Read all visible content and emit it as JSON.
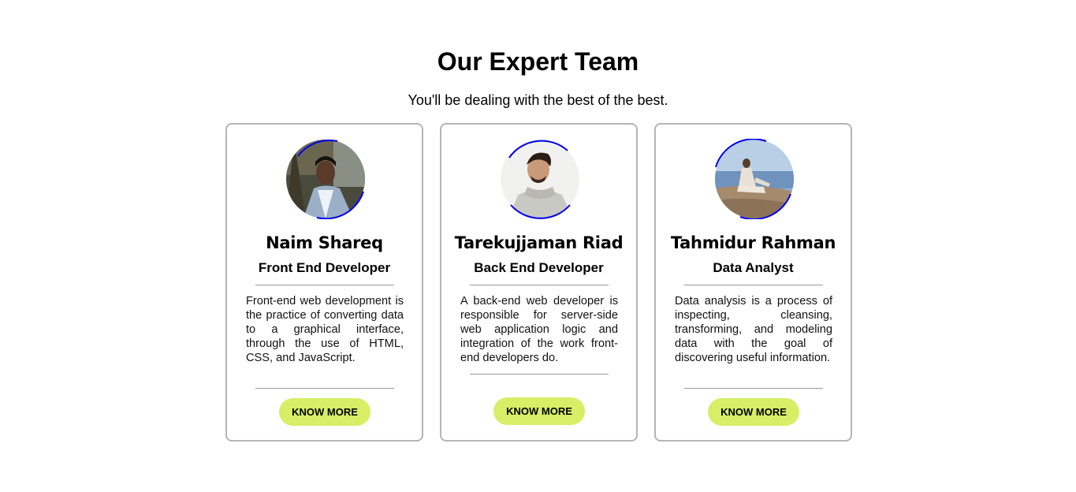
{
  "header": {
    "title": "Our Expert Team",
    "subtitle": "You'll be dealing with the best of the best."
  },
  "colors": {
    "button_bg": "#d7ee66",
    "ring": "#0000ee",
    "card_border": "#b5b5b5"
  },
  "members": [
    {
      "name": "Naim Shareq",
      "role": "Front End Developer",
      "description": "Front-end web development is the practice of converting data to a graphical interface, through the use of HTML, CSS, and JavaScript.",
      "button_label": "KNOW MORE"
    },
    {
      "name": "Tarekujjaman Riad",
      "role": "Back End Developer",
      "description": "A back-end web developer is responsible for server-side web application logic and integration of the work front-end developers do.",
      "button_label": "KNOW MORE"
    },
    {
      "name": "Tahmidur Rahman",
      "role": "Data Analyst",
      "description": "Data analysis is a process of inspecting, cleansing, transforming, and modeling data with the goal of discovering useful information.",
      "button_label": "KNOW MORE"
    }
  ]
}
